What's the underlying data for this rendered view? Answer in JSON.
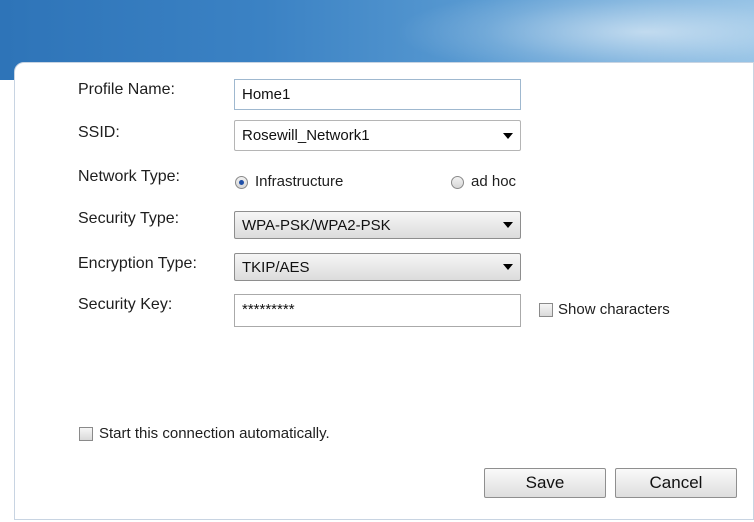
{
  "form": {
    "profile_name": {
      "label": "Profile Name:",
      "value": "Home1"
    },
    "ssid": {
      "label": "SSID:",
      "selected": "Rosewill_Network1"
    },
    "network_type": {
      "label": "Network Type:",
      "options": [
        {
          "label": "Infrastructure",
          "checked": true
        },
        {
          "label": "ad hoc",
          "checked": false
        }
      ]
    },
    "security_type": {
      "label": "Security Type:",
      "selected": "WPA-PSK/WPA2-PSK"
    },
    "encryption_type": {
      "label": "Encryption Type:",
      "selected": "TKIP/AES"
    },
    "security_key": {
      "label": "Security Key:",
      "value": "*********"
    },
    "show_characters": {
      "label": "Show characters",
      "checked": false
    },
    "auto_start": {
      "label": "Start this connection automatically.",
      "checked": false
    }
  },
  "buttons": {
    "save_label": "Save",
    "cancel_label": "Cancel"
  },
  "colors": {
    "header_blue": "#2e74b8",
    "header_light": "#8cbde3",
    "radio_dot": "#1f4fa8"
  },
  "icons": {
    "dropdown": "chevron-down-icon"
  }
}
